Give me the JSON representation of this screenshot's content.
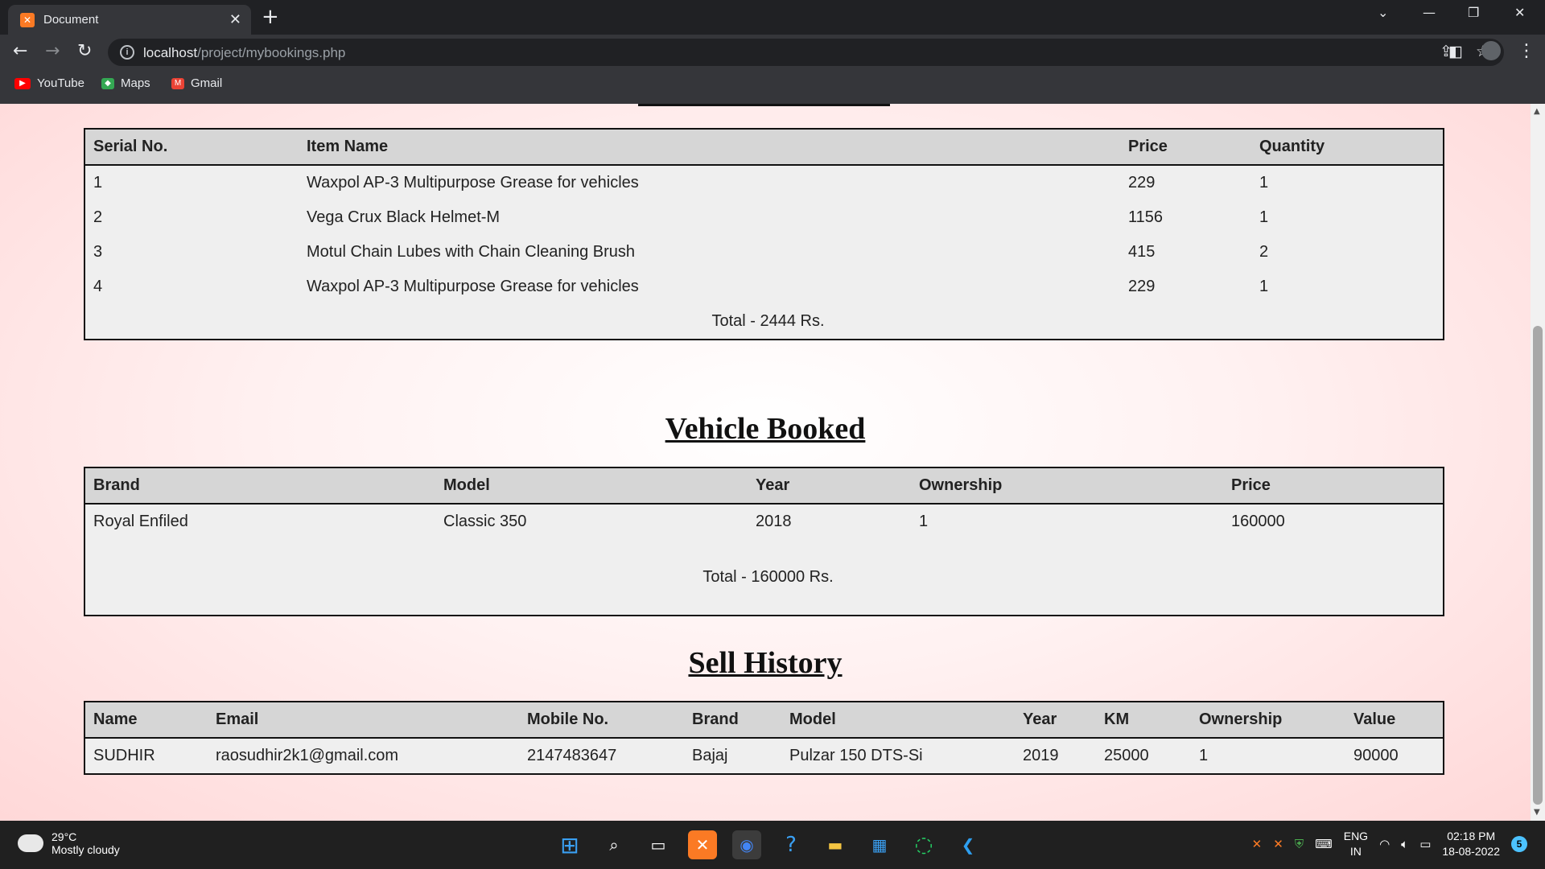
{
  "browser": {
    "tab_title": "Document",
    "url_host": "localhost",
    "url_path": "/project/mybookings.php",
    "bookmarks": [
      {
        "label": "YouTube",
        "icon": "youtube-icon"
      },
      {
        "label": "Maps",
        "icon": "maps-icon"
      },
      {
        "label": "Gmail",
        "icon": "gmail-icon"
      }
    ]
  },
  "items": {
    "headers": [
      "Serial No.",
      "Item Name",
      "Price",
      "Quantity"
    ],
    "rows": [
      [
        "1",
        "Waxpol AP-3 Multipurpose Grease for vehicles",
        "229",
        "1"
      ],
      [
        "2",
        "Vega Crux Black Helmet-M",
        "1156",
        "1"
      ],
      [
        "3",
        "Motul Chain Lubes with Chain Cleaning Brush",
        "415",
        "2"
      ],
      [
        "4",
        "Waxpol AP-3 Multipurpose Grease for vehicles",
        "229",
        "1"
      ]
    ],
    "total": "Total - 2444 Rs."
  },
  "vehicle": {
    "title": "Vehicle Booked",
    "headers": [
      "Brand",
      "Model",
      "Year",
      "Ownership",
      "Price"
    ],
    "rows": [
      [
        "Royal Enfiled",
        "Classic 350",
        "2018",
        "1",
        "160000"
      ]
    ],
    "total": "Total - 160000 Rs."
  },
  "sell": {
    "title": "Sell History",
    "headers": [
      "Name",
      "Email",
      "Mobile No.",
      "Brand",
      "Model",
      "Year",
      "KM",
      "Ownership",
      "Value"
    ],
    "rows": [
      [
        "SUDHIR",
        "raosudhir2k1@gmail.com",
        "2147483647",
        "Bajaj",
        "Pulzar 150 DTS-Si",
        "2019",
        "25000",
        "1",
        "90000"
      ]
    ]
  },
  "taskbar": {
    "weather_temp": "29°C",
    "weather_desc": "Mostly cloudy",
    "lang_top": "ENG",
    "lang_bottom": "IN",
    "time": "02:18 PM",
    "date": "18-08-2022",
    "notifications": "5"
  }
}
